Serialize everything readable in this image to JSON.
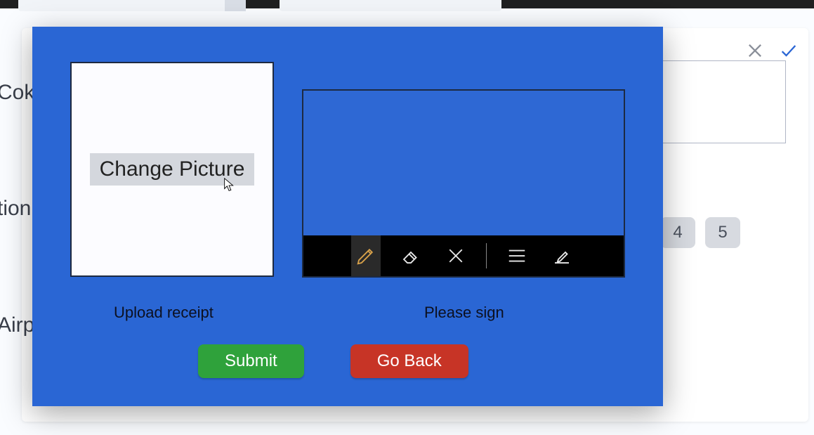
{
  "background": {
    "text_fragments": [
      "Coke",
      "tion",
      "Airp"
    ],
    "chips": [
      "4",
      "5"
    ]
  },
  "modal": {
    "upload": {
      "button_label": "Change Picture",
      "caption": "Upload receipt"
    },
    "signature": {
      "caption": "Please sign",
      "tools": {
        "pen": "pen-icon",
        "eraser": "eraser-icon",
        "clear": "clear-icon",
        "lines": "lines-icon",
        "edit": "edit-icon"
      }
    },
    "actions": {
      "submit": "Submit",
      "go_back": "Go Back"
    }
  }
}
